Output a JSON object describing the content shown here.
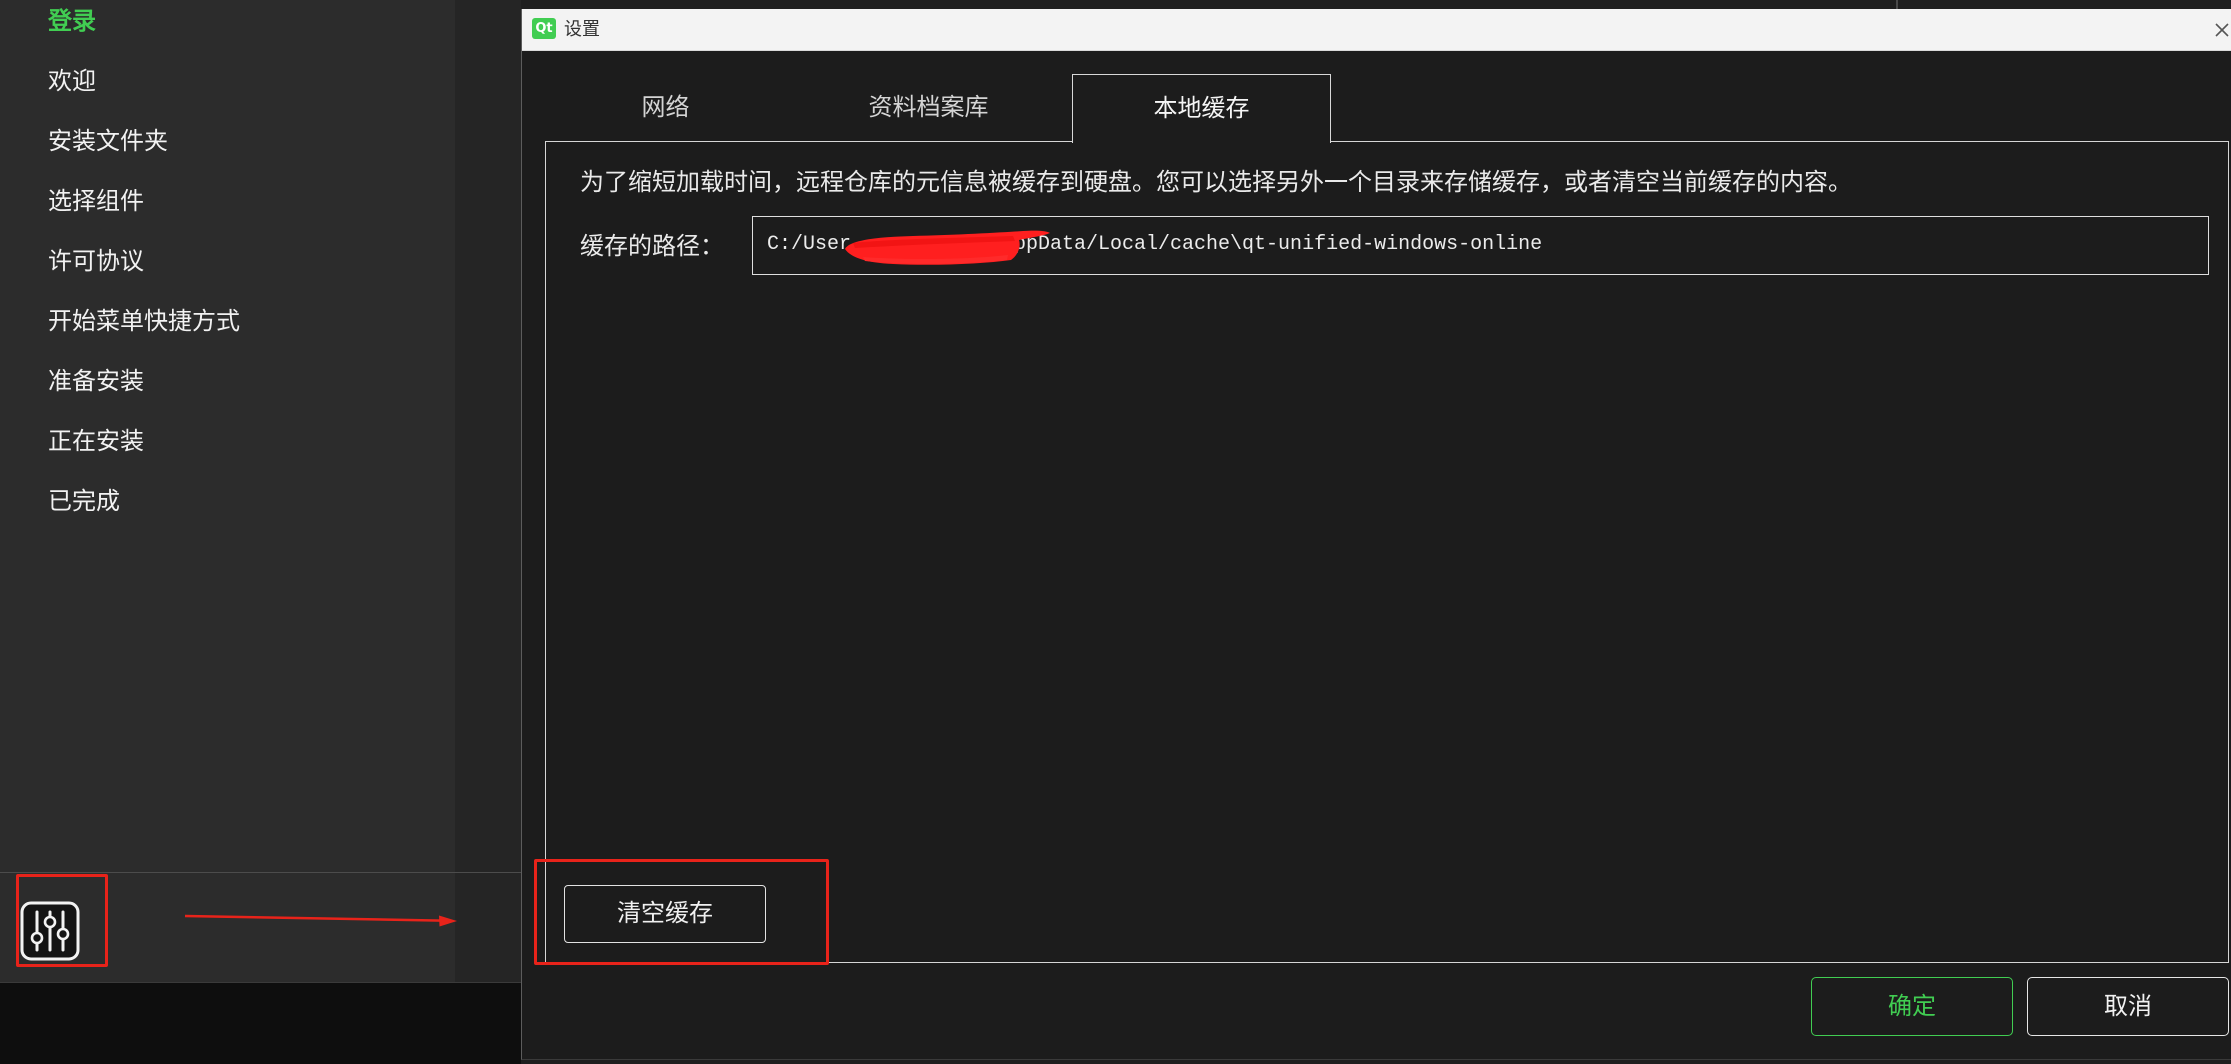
{
  "colors": {
    "accent": "#41cd52",
    "annotation": "#e8231a",
    "redaction": "#ff1f1f"
  },
  "icons": {
    "settings": "sliders-icon",
    "logo": "qt-logo",
    "close": "close-icon",
    "annotation_arrow": "arrow-right-icon"
  },
  "sidebar": {
    "items": [
      {
        "label": "登录",
        "active": true
      },
      {
        "label": "欢迎",
        "active": false
      },
      {
        "label": "安装文件夹",
        "active": false
      },
      {
        "label": "选择组件",
        "active": false
      },
      {
        "label": "许可协议",
        "active": false
      },
      {
        "label": "开始菜单快捷方式",
        "active": false
      },
      {
        "label": "准备安装",
        "active": false
      },
      {
        "label": "正在安装",
        "active": false
      },
      {
        "label": "已完成",
        "active": false
      }
    ]
  },
  "dialog": {
    "logo_text": "Qt",
    "title": "设置",
    "tabs": [
      {
        "label": "网络",
        "active": false
      },
      {
        "label": "资料档案库",
        "active": false
      },
      {
        "label": "本地缓存",
        "active": true
      }
    ],
    "local_cache": {
      "description": "为了缩短加载时间，远程仓库的元信息被缓存到硬盘。您可以选择另外一个目录来存储缓存，或者清空当前缓存的内容。",
      "path_label": "缓存的路径：",
      "path_value_visible_start": "C:/User",
      "path_value_visible_end": "ppData/Local/cache\\qt-unified-windows-online",
      "path_value_redacted": true,
      "clear_button": "清空缓存"
    },
    "buttons": {
      "ok": "确定",
      "cancel": "取消"
    }
  }
}
